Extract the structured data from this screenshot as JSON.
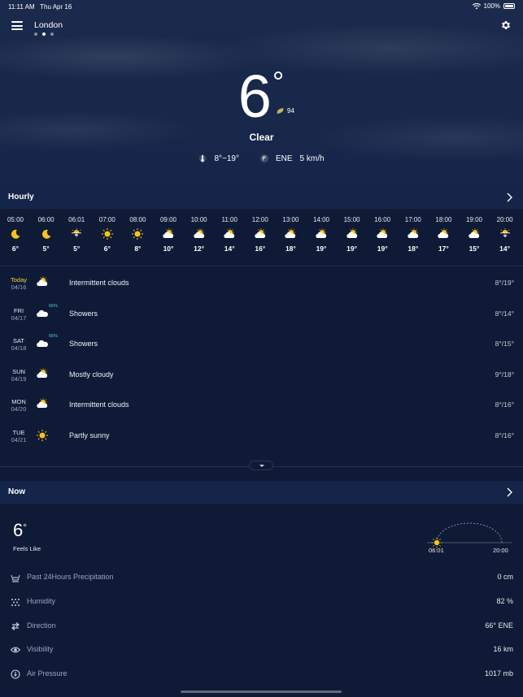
{
  "status_bar": {
    "time": "11:11 AM",
    "date": "Thu Apr 16",
    "battery": "100%"
  },
  "header": {
    "city": "London",
    "pages": 3,
    "active_page": 1
  },
  "current": {
    "temp": "6",
    "deg": "°",
    "aqi": "94",
    "condition": "Clear",
    "range": "8°~19°",
    "wind_dir": "ENE",
    "wind_speed": "5 km/h"
  },
  "hourly_section": {
    "title": "Hourly"
  },
  "hourly": [
    {
      "time": "05:00",
      "icon": "moon",
      "temp": "6°"
    },
    {
      "time": "06:00",
      "icon": "moon",
      "temp": "5°"
    },
    {
      "time": "06:01",
      "icon": "sunrise",
      "temp": "5°"
    },
    {
      "time": "07:00",
      "icon": "sun",
      "temp": "6°"
    },
    {
      "time": "08:00",
      "icon": "sun",
      "temp": "8°"
    },
    {
      "time": "09:00",
      "icon": "partly-cloudy",
      "temp": "10°"
    },
    {
      "time": "10:00",
      "icon": "partly-cloudy",
      "temp": "12°"
    },
    {
      "time": "11:00",
      "icon": "partly-cloudy",
      "temp": "14°"
    },
    {
      "time": "12:00",
      "icon": "partly-cloudy",
      "temp": "16°"
    },
    {
      "time": "13:00",
      "icon": "partly-cloudy",
      "temp": "18°"
    },
    {
      "time": "14:00",
      "icon": "partly-cloudy",
      "temp": "19°"
    },
    {
      "time": "15:00",
      "icon": "partly-cloudy",
      "temp": "19°"
    },
    {
      "time": "16:00",
      "icon": "partly-cloudy",
      "temp": "19°"
    },
    {
      "time": "17:00",
      "icon": "partly-cloudy",
      "temp": "18°"
    },
    {
      "time": "18:00",
      "icon": "partly-cloudy",
      "temp": "17°"
    },
    {
      "time": "19:00",
      "icon": "partly-cloudy",
      "temp": "15°"
    },
    {
      "time": "20:00",
      "icon": "sunset",
      "temp": "14°"
    }
  ],
  "daily": [
    {
      "day": "Today",
      "date": "04/16",
      "icon": "partly-cloudy",
      "pct": "",
      "text": "Intermittent clouds",
      "range": "8°/19°",
      "today": true
    },
    {
      "day": "FRI",
      "date": "04/17",
      "icon": "cloud-rain",
      "pct": "66%",
      "text": "Showers",
      "range": "8°/14°",
      "today": false
    },
    {
      "day": "SAT",
      "date": "04/18",
      "icon": "cloud-rain",
      "pct": "66%",
      "text": "Showers",
      "range": "8°/15°",
      "today": false
    },
    {
      "day": "SUN",
      "date": "04/19",
      "icon": "partly-cloudy",
      "pct": "",
      "text": "Mostly cloudy",
      "range": "9°/18°",
      "today": false
    },
    {
      "day": "MON",
      "date": "04/20",
      "icon": "partly-cloudy",
      "pct": "",
      "text": "Intermittent clouds",
      "range": "8°/16°",
      "today": false
    },
    {
      "day": "TUE",
      "date": "04/21",
      "icon": "sun",
      "pct": "",
      "text": "Partly sunny",
      "range": "8°/16°",
      "today": false
    }
  ],
  "now_section": {
    "title": "Now",
    "feels_temp": "6",
    "feels_deg": "°",
    "feels_label": "Feels Like",
    "sunrise": "06:01",
    "sunset": "20:00"
  },
  "details": [
    {
      "icon": "precipitation-icon",
      "label": "Past 24Hours Precipitation",
      "value": "0 cm"
    },
    {
      "icon": "humidity-icon",
      "label": "Humidity",
      "value": "82 %"
    },
    {
      "icon": "wind-direction-icon",
      "label": "Direction",
      "value": "66° ENE"
    },
    {
      "icon": "visibility-icon",
      "label": "Visibility",
      "value": "16 km"
    },
    {
      "icon": "pressure-icon",
      "label": "Air Pressure",
      "value": "1017 mb"
    }
  ],
  "colors": {
    "background": "#0f1a36",
    "section_header": "#15254a",
    "sun": "#f5c518",
    "rain_pct": "#48d1c8",
    "today": "#f2d24b"
  }
}
